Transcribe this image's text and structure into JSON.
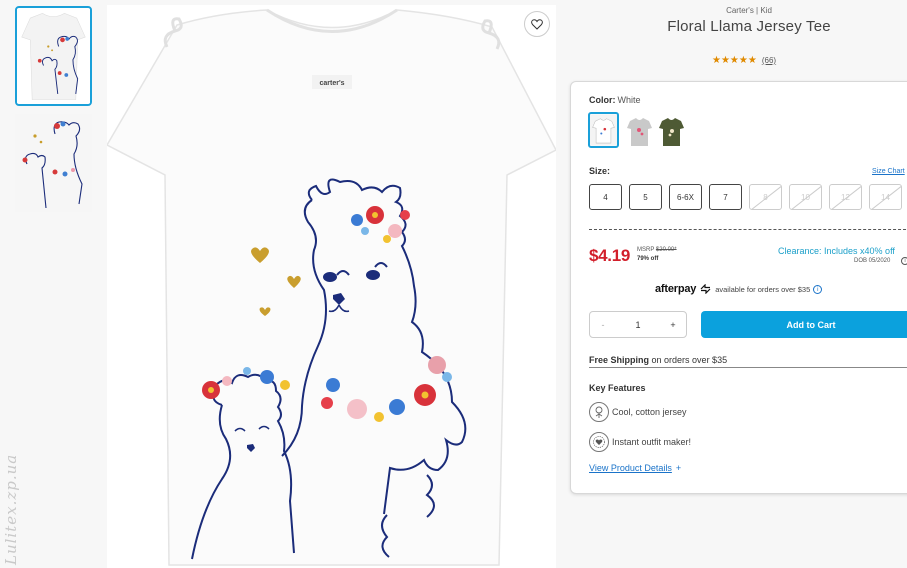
{
  "product": {
    "brand_line": "Carter's | Kid",
    "title": "Floral Llama Jersey Tee",
    "stars": "★★★★★",
    "rating_value": 5,
    "review_count": "(66)"
  },
  "gallery": {
    "watermark": "Lulitex.zp.ua"
  },
  "color": {
    "label": "Color:",
    "selected": "White",
    "swatches": [
      {
        "name": "White",
        "color": "#ffffff",
        "selected": true
      },
      {
        "name": "Gray",
        "color": "#c9c9c9",
        "selected": false
      },
      {
        "name": "Olive",
        "color": "#4e5a34",
        "selected": false
      }
    ]
  },
  "size": {
    "label": "Size:",
    "chart_link": "Size Chart",
    "options": [
      {
        "label": "4",
        "available": true
      },
      {
        "label": "5",
        "available": true
      },
      {
        "label": "6-6X",
        "available": true
      },
      {
        "label": "7",
        "available": true
      },
      {
        "label": "8",
        "available": false
      },
      {
        "label": "10",
        "available": false
      },
      {
        "label": "12",
        "available": false
      },
      {
        "label": "14",
        "available": false
      }
    ]
  },
  "pricing": {
    "price": "$4.19",
    "msrp_label": "MSRP",
    "msrp_value": "$20.00*",
    "percent_off": "79% off",
    "clearance": "Clearance: Includes x40% off",
    "dob": "DOB 05/2020",
    "price_color": "#d21f2b",
    "clearance_color": "#1a9fc9"
  },
  "afterpay": {
    "logo": "afterpay",
    "text": "available for orders over $35",
    "info_icon": "i"
  },
  "cart": {
    "minus": "-",
    "quantity": "1",
    "plus": "+",
    "add_label": "Add to Cart",
    "button_color": "#0ba1dd"
  },
  "shipping": {
    "bold": "Free Shipping",
    "rest": "on orders over $35"
  },
  "features": {
    "title": "Key Features",
    "items": [
      {
        "icon": "cotton-icon",
        "text": "Cool, cotton jersey"
      },
      {
        "icon": "outfit-icon",
        "text": "Instant outfit maker!"
      }
    ],
    "details_link": "View Product Details",
    "details_plus": "+"
  },
  "colors": {
    "accent": "#1aa0d9",
    "star": "#e08a00",
    "link": "#1a73c9"
  }
}
